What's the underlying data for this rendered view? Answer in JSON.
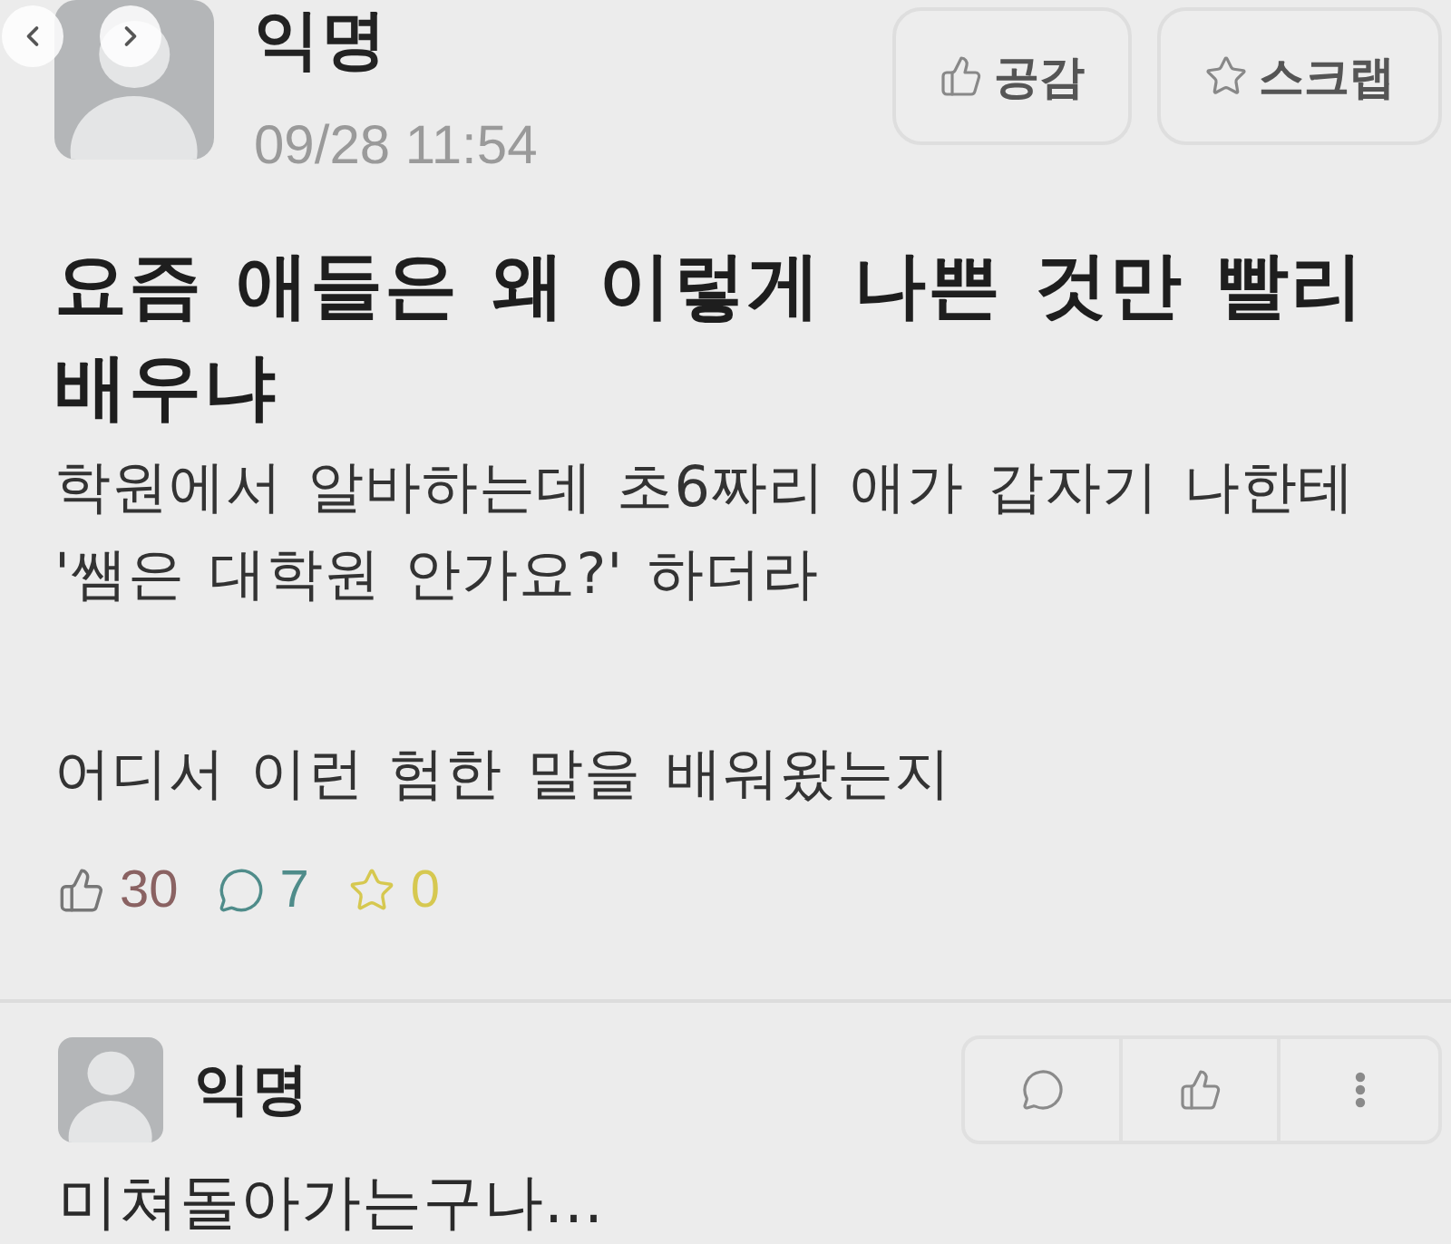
{
  "post": {
    "author": "익명",
    "time": "09/28 11:54",
    "actions": [
      {
        "kind": "like",
        "label": "공감"
      },
      {
        "kind": "scrap",
        "label": "스크랩"
      }
    ],
    "title": "요즘 애들은 왜 이렇게 나쁜 것만 빨리 배우냐",
    "body": [
      "학원에서 알바하는데 초6짜리 애가 갑자기 나한테 '쌤은 대학원 안가요?' 하더라",
      "어디서 이런 험한 말을 배워왔는지"
    ],
    "stats": [
      {
        "kind": "like",
        "count": "30",
        "color": "#8a6262"
      },
      {
        "kind": "comment",
        "count": "7",
        "color": "#4f8c8a"
      },
      {
        "kind": "scrap",
        "count": "0",
        "color": "#d6c850"
      }
    ]
  },
  "comments": [
    {
      "author": "익명",
      "text": "미쳐돌아가는구나...",
      "actions": [
        {
          "kind": "reply"
        },
        {
          "kind": "like"
        },
        {
          "kind": "more"
        }
      ]
    }
  ]
}
